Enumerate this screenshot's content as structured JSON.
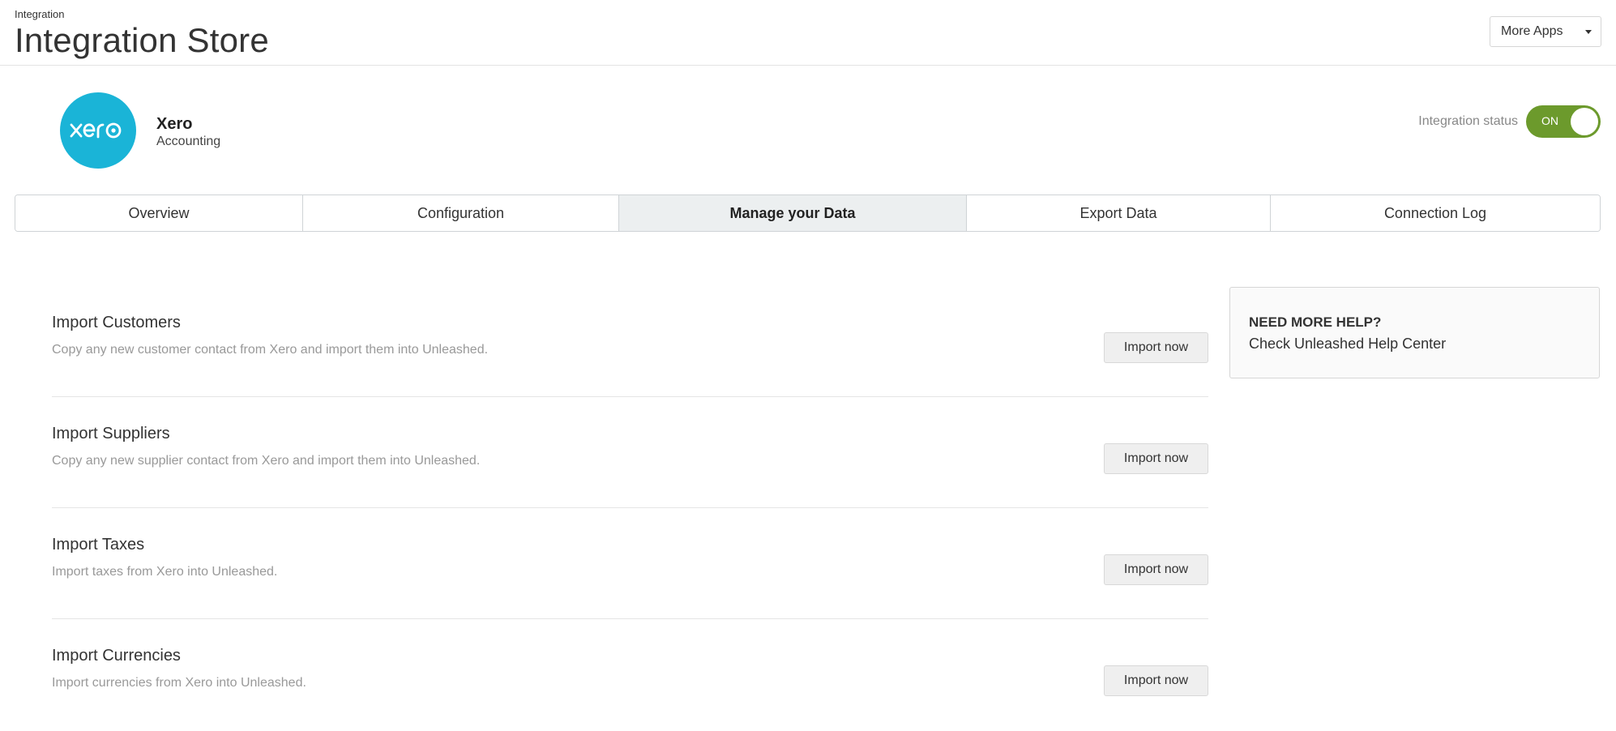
{
  "header": {
    "breadcrumb": "Integration",
    "title": "Integration Store",
    "more_apps_label": "More Apps"
  },
  "app": {
    "logo_text": "xero",
    "name": "Xero",
    "category": "Accounting",
    "brand_color": "#1ab4d7"
  },
  "status": {
    "label": "Integration status",
    "toggle_text": "ON",
    "toggle_color": "#6c9a2c",
    "is_on": true
  },
  "tabs": [
    {
      "label": "Overview",
      "active": false
    },
    {
      "label": "Configuration",
      "active": false
    },
    {
      "label": "Manage your Data",
      "active": true
    },
    {
      "label": "Export Data",
      "active": false
    },
    {
      "label": "Connection Log",
      "active": false
    }
  ],
  "imports": [
    {
      "title": "Import Customers",
      "description": "Copy any new customer contact from Xero and import them into Unleashed.",
      "button": "Import now"
    },
    {
      "title": "Import Suppliers",
      "description": "Copy any new supplier contact from Xero and import them into Unleashed.",
      "button": "Import now"
    },
    {
      "title": "Import Taxes",
      "description": "Import taxes from Xero into Unleashed.",
      "button": "Import now"
    },
    {
      "title": "Import Currencies",
      "description": "Import currencies from Xero into Unleashed.",
      "button": "Import now"
    }
  ],
  "help": {
    "title": "NEED MORE HELP?",
    "link": "Check Unleashed Help Center"
  }
}
